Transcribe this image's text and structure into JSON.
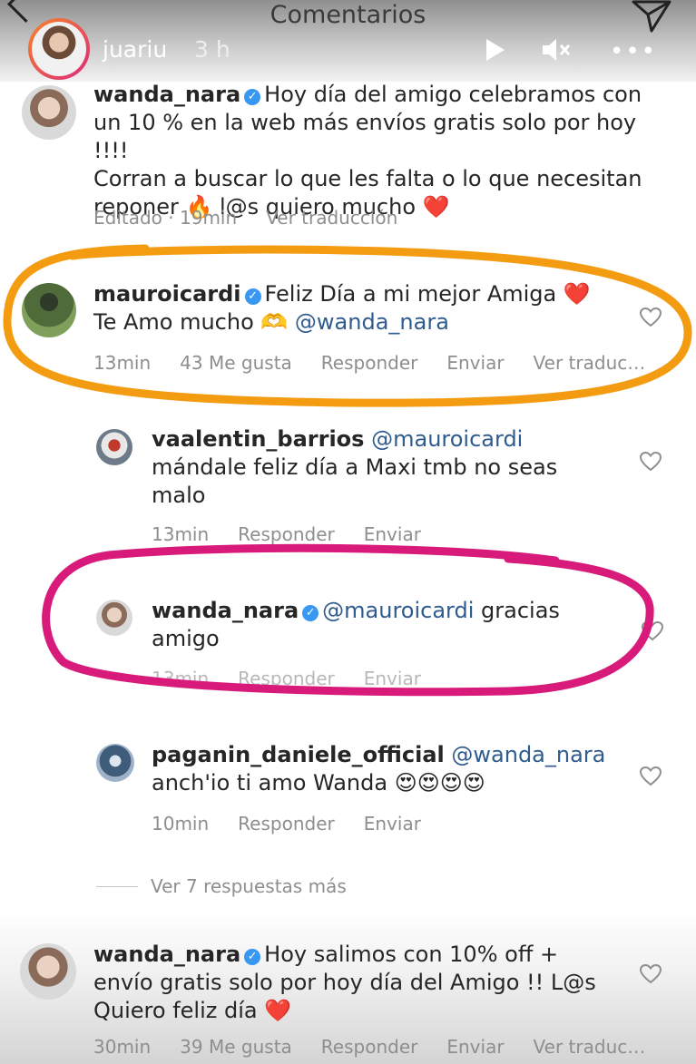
{
  "header": {
    "title": "Comentarios"
  },
  "story": {
    "username": "juariu",
    "time": "3 h"
  },
  "comments": [
    {
      "username": "wanda_nara",
      "lines": [
        "Hoy día del amigo  celebramos con",
        "un 10 % en la web más envíos gratis solo por hoy !!!!",
        "Corran a buscar lo que les falta o lo que necesitan",
        "reponer 🔥 l@s quiero mucho ❤️"
      ],
      "meta": [
        "Editado · 19min",
        "Ver traducción"
      ]
    },
    {
      "username": "mauroicardi",
      "text1": "Feliz Día a mi mejor Amiga ❤️",
      "text2": "Te Amo mucho 🫶",
      "mention": "@wanda_nara",
      "meta": [
        "13min",
        "43 Me gusta",
        "Responder",
        "Enviar",
        "Ver traduc…"
      ]
    },
    {
      "username": "vaalentin_barrios",
      "mention": "@mauroicardi",
      "lines": [
        "mándale feliz día a Maxi tmb no seas",
        "malo"
      ],
      "meta": [
        "13min",
        "Responder",
        "Enviar"
      ]
    },
    {
      "username": "wanda_nara",
      "mention": "@mauroicardi",
      "text1": "gracias",
      "text2": "amigo",
      "meta": [
        "13min",
        "Responder",
        "Enviar"
      ]
    },
    {
      "username": "paganin_daniele_official",
      "mention": "@wanda_nara",
      "text2": "anch'io ti amo Wanda 😍😍😍😍",
      "meta": [
        "10min",
        "Responder",
        "Enviar"
      ]
    },
    {
      "username": "wanda_nara",
      "lines": [
        "Hoy salimos con 10% off +",
        "envío gratis solo por hoy día del Amigo !! L@s",
        "Quiero feliz día ❤️"
      ],
      "meta": [
        "30min",
        "39 Me gusta",
        "Responder",
        "Enviar",
        "Ver traduc…"
      ]
    }
  ],
  "more_replies": "Ver 7 respuestas más",
  "colors": {
    "highlight_orange": "#f39c12",
    "highlight_pink": "#d81b7a",
    "mention_blue": "#2f5b8f"
  }
}
